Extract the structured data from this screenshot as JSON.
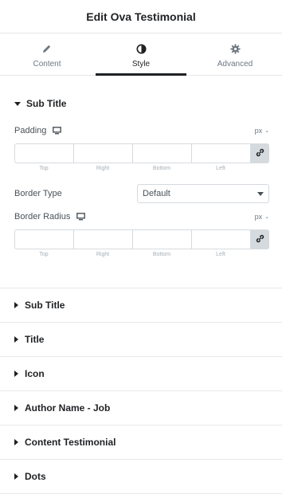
{
  "header": {
    "title": "Edit Ova Testimonial"
  },
  "tabs": [
    {
      "label": "Content",
      "icon": "pencil-icon"
    },
    {
      "label": "Style",
      "icon": "contrast-icon",
      "active": true
    },
    {
      "label": "Advanced",
      "icon": "gear-icon"
    }
  ],
  "section": {
    "title": "Sub Title",
    "padding": {
      "label": "Padding",
      "unit": "px",
      "fields": [
        "Top",
        "Right",
        "Bottom",
        "Left"
      ]
    },
    "border_type": {
      "label": "Border Type",
      "value": "Default"
    },
    "border_radius": {
      "label": "Border Radius",
      "unit": "px",
      "fields": [
        "Top",
        "Right",
        "Bottom",
        "Left"
      ]
    }
  },
  "accordions": [
    "Sub Title",
    "Title",
    "Icon",
    "Author Name - Job",
    "Content Testimonial",
    "Dots"
  ],
  "colors": {
    "text": "#1f2124",
    "muted": "#6d7882",
    "border": "#d5dadf",
    "link_bg": "#d5dadf"
  }
}
